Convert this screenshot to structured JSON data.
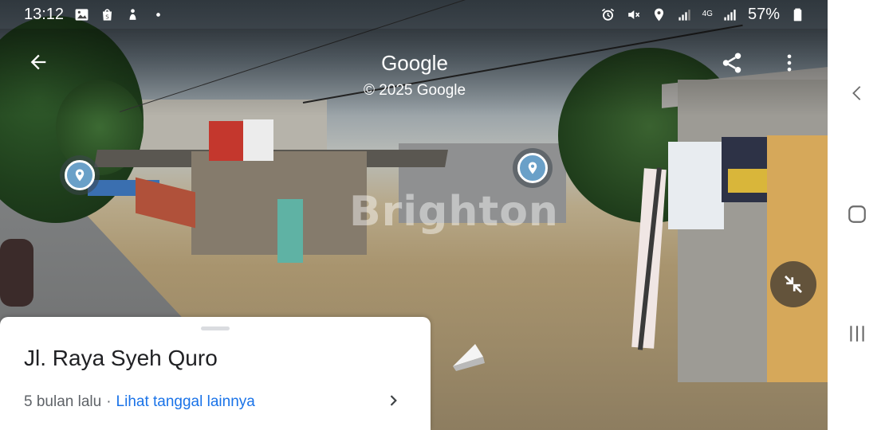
{
  "status_bar": {
    "time": "13:12",
    "battery": "57%",
    "network_label": "4G"
  },
  "viewer": {
    "brand": "Google",
    "copyright": "© 2025 Google",
    "watermark": "Brighton"
  },
  "place_card": {
    "title": "Jl. Raya Syeh Quro",
    "capture_age": "5 bulan lalu",
    "separator": "·",
    "more_dates_link": "Lihat tanggal lainnya"
  },
  "colors": {
    "link_blue": "#1a73e8",
    "marker_blue": "#6aa0c8",
    "title_text": "#202124",
    "secondary_text": "#5f6368"
  },
  "icons": {
    "status": [
      "gallery-icon",
      "shopping-bag-icon",
      "figure-icon",
      "dot-icon",
      "alarm-icon",
      "mute-icon",
      "location-icon",
      "signal-icon",
      "battery-icon"
    ],
    "toolbar": [
      "back-arrow-icon",
      "share-icon",
      "more-vert-icon"
    ],
    "markers": [
      "place-marker-icon"
    ],
    "controls": [
      "exit-fullscreen-icon",
      "navigation-arrow-icon",
      "chevron-right-icon"
    ],
    "system_nav": [
      "nav-back-icon",
      "nav-home-icon",
      "nav-recents-icon"
    ]
  }
}
